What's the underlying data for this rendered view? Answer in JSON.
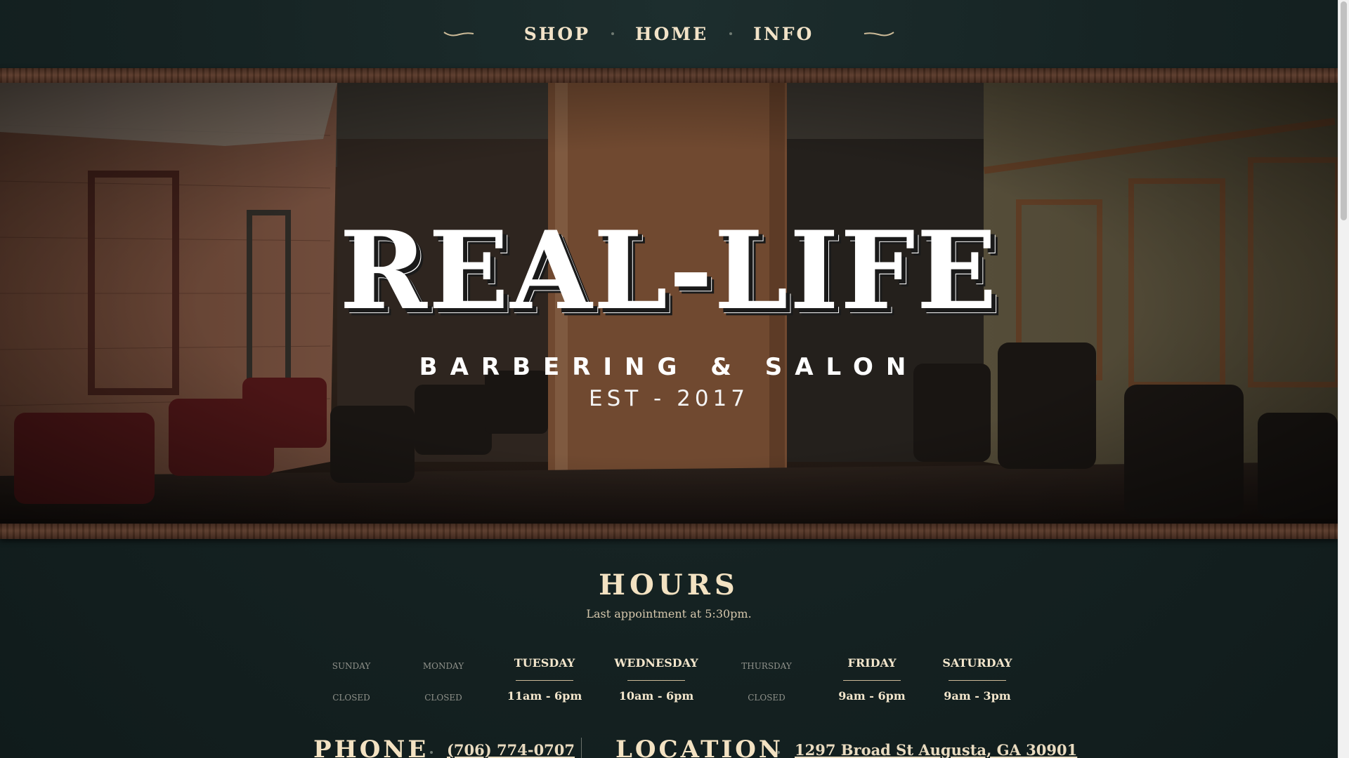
{
  "nav": {
    "items": [
      "SHOP",
      "HOME",
      "INFO"
    ]
  },
  "hero": {
    "title": "REAL-LIFE",
    "subtitle": "BARBERING & SALON",
    "established": "EST - 2017"
  },
  "hours": {
    "title": "HOURS",
    "note": "Last appointment at 5:30pm.",
    "days": [
      {
        "name": "SUNDAY",
        "hours": "CLOSED",
        "closed": true
      },
      {
        "name": "MONDAY",
        "hours": "CLOSED",
        "closed": true
      },
      {
        "name": "TUESDAY",
        "hours": "11am - 6pm",
        "closed": false
      },
      {
        "name": "WEDNESDAY",
        "hours": "10am - 6pm",
        "closed": false
      },
      {
        "name": "THURSDAY",
        "hours": "CLOSED",
        "closed": true
      },
      {
        "name": "FRIDAY",
        "hours": "9am - 6pm",
        "closed": false
      },
      {
        "name": "SATURDAY",
        "hours": "9am - 3pm",
        "closed": false
      }
    ]
  },
  "contact": {
    "phone_label": "PHONE",
    "phone_value": "(706) 774-0707",
    "location_label": "LOCATION",
    "location_value": "1297 Broad St Augusta, GA 30901"
  },
  "colors": {
    "background": "#172626",
    "accent_text": "#f3e2c2",
    "wood_frame": "#4a2e21"
  },
  "icons": [
    "left-flourish-icon",
    "right-flourish-icon"
  ]
}
